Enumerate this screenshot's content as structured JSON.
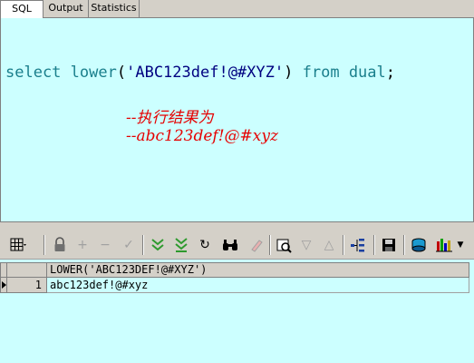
{
  "tabs": [
    {
      "label": "SQL",
      "active": true
    },
    {
      "label": "Output",
      "active": false
    },
    {
      "label": "Statistics",
      "active": false
    }
  ],
  "editor": {
    "code": {
      "select": "select",
      "space1": " ",
      "fn": "lower",
      "open": "(",
      "literal": "'ABC123def!@#XYZ'",
      "close": ")",
      "space2": " ",
      "from": "from",
      "space3": " ",
      "table": "dual",
      "semi": ";"
    },
    "comments": [
      "--执行结果为",
      "--abc123def!@#xyz"
    ]
  },
  "toolbar": {
    "icons": [
      "grid-menu-icon",
      "lock-icon",
      "insert-record-icon",
      "delete-record-icon",
      "post-changes-icon",
      "next-page-icon",
      "last-page-icon",
      "refresh-icon",
      "find-icon",
      "clear-icon",
      "query-by-example-icon",
      "filter-up-icon",
      "filter-down-icon",
      "tree-icon",
      "save-icon",
      "export-icon",
      "chart-icon"
    ]
  },
  "grid": {
    "columns": [
      "LOWER('ABC123DEF!@#XYZ')"
    ],
    "rows": [
      {
        "num": "1",
        "cells": [
          "abc123def!@#xyz"
        ]
      }
    ]
  },
  "colors": {
    "editor_bg": "#ccffff",
    "keyword": "#1a7f8c",
    "comment": "#e60000",
    "chrome": "#d4d0c8"
  }
}
